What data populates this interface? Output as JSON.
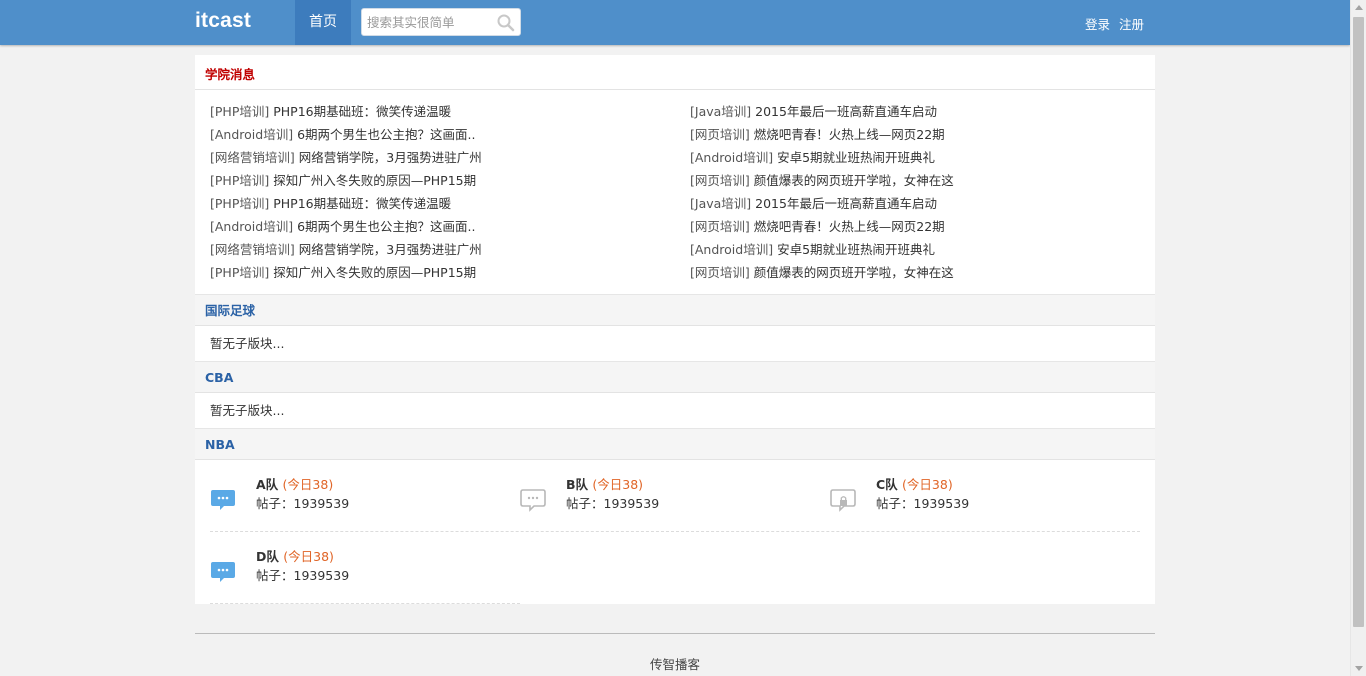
{
  "header": {
    "logo": "itcast",
    "nav_home": "首页",
    "search_placeholder": "搜索其实很简单",
    "login": "登录",
    "register": "注册"
  },
  "news": {
    "title": "学院消息",
    "left": [
      {
        "tag": "[PHP培训]",
        "text": "PHP16期基础班：微笑传递温暖"
      },
      {
        "tag": "[Android培训]",
        "text": "6期两个男生也公主抱？这画面.."
      },
      {
        "tag": "[网络营销培训]",
        "text": "网络营销学院，3月强势进驻广州"
      },
      {
        "tag": "[PHP培训]",
        "text": "探知广州入冬失败的原因—PHP15期"
      },
      {
        "tag": "[PHP培训]",
        "text": "PHP16期基础班：微笑传递温暖"
      },
      {
        "tag": "[Android培训]",
        "text": "6期两个男生也公主抱？这画面.."
      },
      {
        "tag": "[网络营销培训]",
        "text": "网络营销学院，3月强势进驻广州"
      },
      {
        "tag": "[PHP培训]",
        "text": "探知广州入冬失败的原因—PHP15期"
      }
    ],
    "right": [
      {
        "tag": "[Java培训]",
        "text": "2015年最后一班高薪直通车启动"
      },
      {
        "tag": "[网页培训]",
        "text": "燃烧吧青春！火热上线—网页22期"
      },
      {
        "tag": "[Android培训]",
        "text": "安卓5期就业班热闹开班典礼"
      },
      {
        "tag": "[网页培训]",
        "text": "颜值爆表的网页班开学啦，女神在这"
      },
      {
        "tag": "[Java培训]",
        "text": "2015年最后一班高薪直通车启动"
      },
      {
        "tag": "[网页培训]",
        "text": "燃烧吧青春！火热上线—网页22期"
      },
      {
        "tag": "[Android培训]",
        "text": "安卓5期就业班热闹开班典礼"
      },
      {
        "tag": "[网页培训]",
        "text": "颜值爆表的网页班开学啦，女神在这"
      }
    ]
  },
  "boards": [
    {
      "title": "国际足球",
      "empty": "暂无子版块..."
    },
    {
      "title": "CBA",
      "empty": "暂无子版块..."
    }
  ],
  "nba": {
    "title": "NBA",
    "forums": [
      {
        "name": "A队",
        "today": "(今日38)",
        "posts": "帖子：1939539",
        "icon": "chat-bubble-new-icon"
      },
      {
        "name": "B队",
        "today": "(今日38)",
        "posts": "帖子：1939539",
        "icon": "chat-bubble-icon"
      },
      {
        "name": "C队",
        "today": "(今日38)",
        "posts": "帖子：1939539",
        "icon": "chat-bubble-locked-icon"
      },
      {
        "name": "D队",
        "today": "(今日38)",
        "posts": "帖子：1939539",
        "icon": "chat-bubble-new-icon"
      }
    ]
  },
  "footer": {
    "text": "传智播客"
  },
  "colors": {
    "header_bg": "#4f8fca",
    "nav_active": "#3d7cbd",
    "news_title": "#c00000",
    "board_title": "#2b62a6",
    "today_count": "#e06527",
    "icon_active": "#5aa9e6",
    "icon_inactive": "#b8b8b8"
  }
}
